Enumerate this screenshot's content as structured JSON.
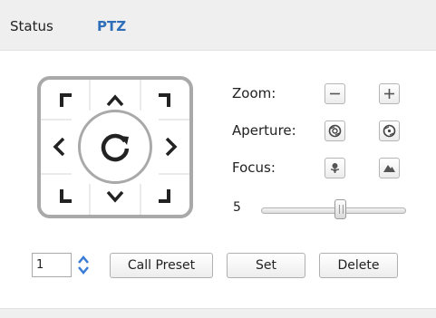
{
  "tabs": [
    {
      "label": "Status",
      "active": false
    },
    {
      "label": "PTZ",
      "active": true
    }
  ],
  "controls": {
    "zoom_label": "Zoom:",
    "aperture_label": "Aperture:",
    "focus_label": "Focus:",
    "speed_value": "5",
    "speed_fraction": 0.55
  },
  "preset": {
    "number": "1",
    "call_label": "Call Preset",
    "set_label": "Set",
    "delete_label": "Delete"
  },
  "colors": {
    "active_tab": "#2f6fba",
    "pad_border": "#a9a9a9",
    "arrow": "#222222",
    "spinner": "#3a7bd5"
  }
}
